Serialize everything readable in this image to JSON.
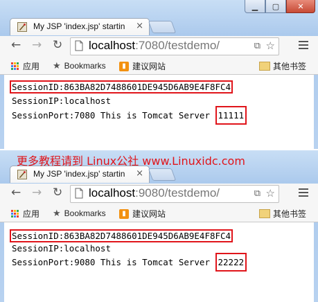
{
  "window1": {
    "tab_title": "My JSP 'index.jsp' startin",
    "url_host": "localhost",
    "url_rest": ":7080/testdemo/",
    "bookmarks": {
      "apps": "应用",
      "bookmarks": "Bookmarks",
      "suggested": "建议网站",
      "other": "其他书签"
    },
    "lines": {
      "session_id": "SessionID:863BA82D7488601DE945D6AB9E4F8FC4",
      "session_ip": "SessionIP:localhost",
      "port_prefix": "SessionPort:7080 This is Tomcat Server ",
      "server_id": "11111"
    }
  },
  "window2": {
    "tab_title": "My JSP 'index.jsp' startin",
    "url_host": "localhost",
    "url_rest": ":9080/testdemo/",
    "bookmarks": {
      "apps": "应用",
      "bookmarks": "Bookmarks",
      "suggested": "建议网站",
      "other": "其他书签"
    },
    "lines": {
      "session_id": "SessionID:863BA82D7488601DE945D6AB9E4F8FC4",
      "session_ip": "SessionIP:localhost",
      "port_prefix": "SessionPort:9080 This is Tomcat Server ",
      "server_id": "22222"
    }
  },
  "watermark": "更多教程请到  Linux公社  www.Linuxidc.com",
  "icons": {
    "back": "arrow-left-icon",
    "forward": "arrow-right-icon",
    "reload": "reload-icon",
    "star": "star-icon",
    "menu": "hamburger-menu-icon"
  },
  "colors": {
    "highlight_box": "#e0141a",
    "frame": "#a9c8ec"
  }
}
